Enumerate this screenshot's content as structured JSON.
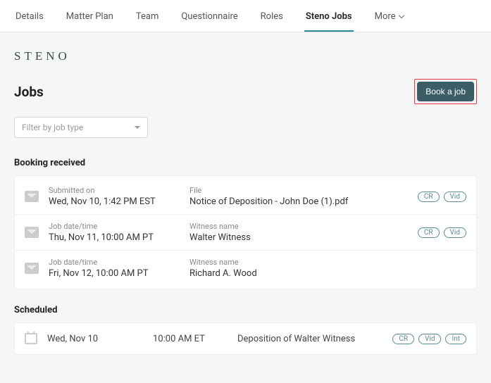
{
  "tabs": {
    "items": [
      "Details",
      "Matter Plan",
      "Team",
      "Questionnaire",
      "Roles",
      "Steno Jobs"
    ],
    "more": "More",
    "active_index": 5
  },
  "logo": "STENO",
  "page_title": "Jobs",
  "book_button": "Book a job",
  "filter_placeholder": "Filter by job type",
  "sections": {
    "booking_received": {
      "title": "Booking received",
      "rows": [
        {
          "label1": "Submitted on",
          "value1": "Wed, Nov 10, 1:42 PM EST",
          "label2": "File",
          "value2": "Notice of Deposition - John Doe (1).pdf",
          "pills": [
            "CR",
            "Vid"
          ]
        },
        {
          "label1": "Job date/time",
          "value1": "Thu, Nov 11, 10:00 AM PT",
          "label2": "Witness name",
          "value2": "Walter Witness",
          "pills": [
            "CR",
            "Vid"
          ]
        },
        {
          "label1": "Job date/time",
          "value1": "Fri, Nov 12, 10:00 AM PT",
          "label2": "Witness name",
          "value2": "Richard A. Wood",
          "pills": []
        }
      ]
    },
    "scheduled": {
      "title": "Scheduled",
      "rows": [
        {
          "date": "Wed, Nov 10",
          "time": "10:00 AM ET",
          "desc": "Deposition of Walter Witness",
          "pills": [
            "CR",
            "Vid",
            "Int"
          ]
        }
      ]
    }
  }
}
